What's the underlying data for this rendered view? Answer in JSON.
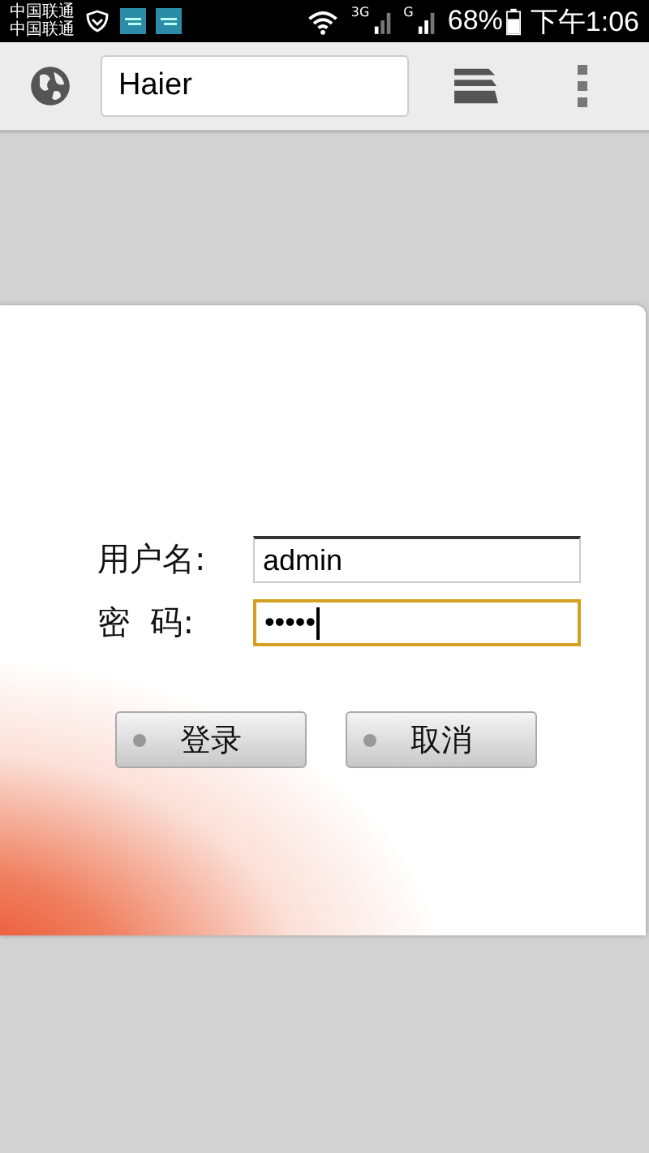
{
  "status_bar": {
    "carriers": [
      "中国联通",
      "中国联通"
    ],
    "network_1": "3G",
    "network_2": "G",
    "battery": "68%",
    "time": "下午1:06"
  },
  "toolbar": {
    "address": "Haier"
  },
  "login": {
    "fields": [
      {
        "label": "用户名:",
        "value": "admin",
        "focused": false
      },
      {
        "label": "密  码:",
        "value": "•••••",
        "focused": true
      }
    ],
    "buttons": [
      "登录",
      "取消"
    ]
  }
}
